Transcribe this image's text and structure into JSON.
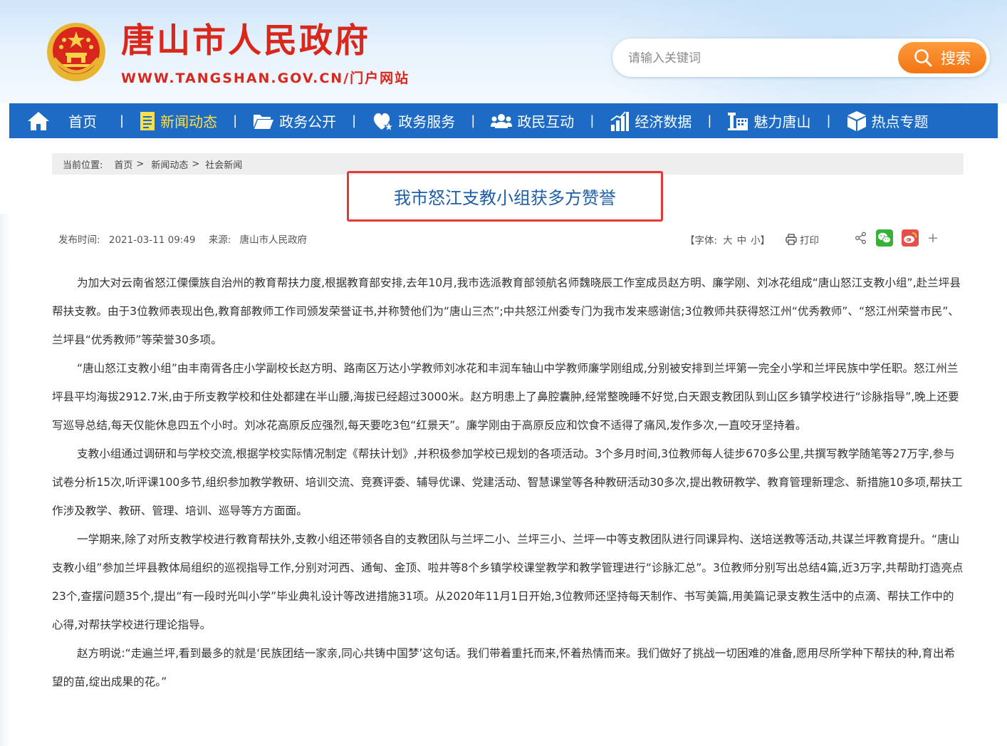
{
  "header": {
    "site_title": "唐山市人民政府",
    "site_url": "WWW.TANGSHAN.GOV.CN/门户网站",
    "emblem_icon": "national-emblem-icon",
    "search": {
      "placeholder": "请输入关键词",
      "button_label": "搜索",
      "button_icon": "search-icon"
    }
  },
  "nav": {
    "items": [
      {
        "label": "首页",
        "icon": "home-icon",
        "active": false
      },
      {
        "label": "新闻动态",
        "icon": "document-icon",
        "active": true
      },
      {
        "label": "政务公开",
        "icon": "folder-open-icon",
        "active": false
      },
      {
        "label": "政务服务",
        "icon": "heart-star-icon",
        "active": false
      },
      {
        "label": "政民互动",
        "icon": "users-icon",
        "active": false
      },
      {
        "label": "经济数据",
        "icon": "bar-chart-icon",
        "active": false
      },
      {
        "label": "魅力唐山",
        "icon": "building-icon",
        "active": false
      },
      {
        "label": "热点专题",
        "icon": "cube-icon",
        "active": false
      }
    ],
    "separator": "|",
    "colors": {
      "bar": "#1d6bc4",
      "active_text": "#ffe04a"
    }
  },
  "breadcrumb": {
    "prefix": "当前位置:",
    "items": [
      "首页",
      "新闻动态",
      "社会新闻"
    ],
    "separator": ">"
  },
  "article": {
    "title": "我市怒江支教小组获多方赞誉",
    "publish_label": "发布时间:",
    "publish_time": "2021-03-11 09:49",
    "source_label": "来源:",
    "source": "唐山市人民政府",
    "paragraphs": [
      "为加大对云南省怒江傈僳族自治州的教育帮扶力度,根据教育部安排,去年10月,我市选派教育部领航名师魏晓辰工作室成员赵方明、廉学刚、刘冰花组成“唐山怒江支教小组”,赴兰坪县帮扶支教。由于3位教师表现出色,教育部教师工作司颁发荣誉证书,并称赞他们为“唐山三杰”;中共怒江州委专门为我市发来感谢信;3位教师共获得怒江州“优秀教师”、“怒江州荣誉市民”、兰坪县“优秀教师”等荣誉30多项。",
      "“唐山怒江支教小组”由丰南胥各庄小学副校长赵方明、路南区万达小学教师刘冰花和丰润车轴山中学教师廉学刚组成,分别被安排到兰坪第一完全小学和兰坪民族中学任职。怒江州兰坪县平均海拔2912.7米,由于所支教学校和住处都建在半山腰,海拔已经超过3000米。赵方明患上了鼻腔囊肿,经常整晚睡不好觉,白天跟支教团队到山区乡镇学校进行“诊脉指导”,晚上还要写巡导总结,每天仅能休息四五个小时。刘冰花高原反应强烈,每天要吃3包“红景天”。廉学刚由于高原反应和饮食不适得了痛风,发作多次,一直咬牙坚持着。",
      "支教小组通过调研和与学校交流,根据学校实际情况制定《帮扶计划》,并积极参加学校已规划的各项活动。3个多月时间,3位教师每人徒步670多公里,共撰写教学随笔等27万字,参与试卷分析15次,听评课100多节,组织参加教学教研、培训交流、竞赛评委、辅导优课、党建活动、智慧课堂等各种教研活动30多次,提出教研教学、教育管理新理念、新措施10多项,帮扶工作涉及教学、教研、管理、培训、巡导等方方面面。",
      "一学期来,除了对所支教学校进行教育帮扶外,支教小组还带领各自的支教团队与兰坪二小、兰坪三小、兰坪一中等支教团队进行同课异构、送培送教等活动,共谋兰坪教育提升。“唐山支教小组”参加兰坪县教体局组织的巡视指导工作,分别对河西、通甸、金顶、啦井等8个乡镇学校课堂教学和教学管理进行“诊脉汇总”。3位教师分别写出总结4篇,近3万字,共帮助打造亮点23个,查摆问题35个,提出“有一段时光叫小学”毕业典礼设计等改进措施31项。从2020年11月1日开始,3位教师还坚持每天制作、书写美篇,用美篇记录支教生活中的点滴、帮扶工作中的心得,对帮扶学校进行理论指导。",
      "赵方明说:“走遍兰坪,看到最多的就是‘民族团结一家亲,同心共铸中国梦’这句话。我们带着重托而来,怀着热情而来。我们做好了挑战一切困难的准备,愿用尽所学种下帮扶的种,育出希望的苗,绽出成果的花。”"
    ]
  },
  "tools": {
    "font_label_open": "【字体:",
    "font_large": "大",
    "font_medium": "中",
    "font_small": "小",
    "font_label_close": "】",
    "print_label": "打印",
    "print_icon": "printer-icon"
  },
  "share": {
    "items": [
      {
        "icon": "share-icon"
      },
      {
        "icon": "wechat-icon",
        "color": "#35b339"
      },
      {
        "icon": "weibo-icon",
        "color": "#e6504a"
      },
      {
        "icon": "plus-icon",
        "label": "+"
      }
    ]
  },
  "colors": {
    "title": "#1d5ea6",
    "brand_red": "#d9271c",
    "highlight_box": "#e53935",
    "search_button": "#f27514"
  }
}
